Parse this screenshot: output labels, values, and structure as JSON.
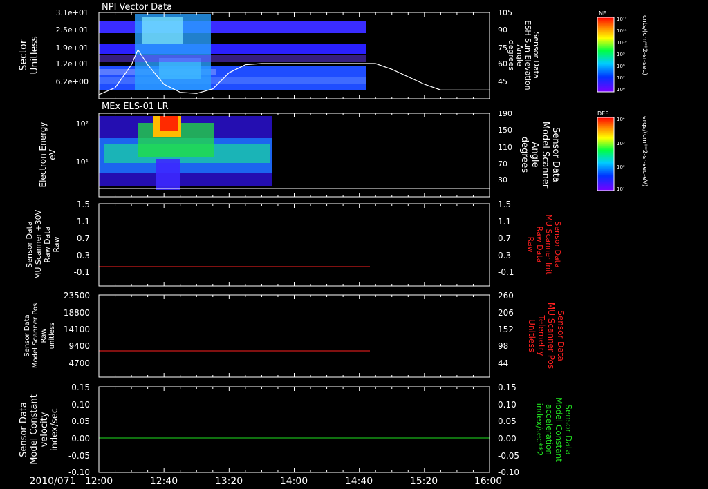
{
  "footer": {
    "date_label": "2010/071"
  },
  "x_ticks": [
    "12:00",
    "12:40",
    "13:20",
    "14:00",
    "14:40",
    "15:20",
    "16:00"
  ],
  "colors": {
    "frame": "#ffffff",
    "red": "#ff2020",
    "green": "#20e020",
    "bg": "#000000"
  },
  "chart_data": [
    {
      "type": "heatmap",
      "title": "NPI Vector Data",
      "ylabel_lines": [
        "Sector",
        "Unitless"
      ],
      "y_ticks": [
        "3.1e+01",
        "2.5e+01",
        "1.9e+01",
        "1.2e+01",
        "6.2e+00"
      ],
      "y_right_ticks": [
        "105",
        "90",
        "75",
        "60",
        "45"
      ],
      "right_label_lines": [
        "Sensor Data",
        "ESH Sun Elevation",
        "Angle",
        "degrees"
      ],
      "colorbar": {
        "label": "NF",
        "unit": "cnts/(cm**2-sr-sec)",
        "ticks": [
          "10¹²",
          "10¹¹",
          "10¹⁰",
          "10⁹",
          "10⁸",
          "10⁷",
          "10⁶"
        ]
      },
      "data_end_time": "14:44",
      "overlay_line": {
        "name": "ESH Sun Elevation Angle",
        "x": [
          "12:00",
          "12:10",
          "12:20",
          "12:24",
          "12:30",
          "12:40",
          "12:50",
          "13:00",
          "13:10",
          "13:20",
          "13:30",
          "13:40",
          "14:00",
          "14:20",
          "14:40",
          "14:50",
          "15:00",
          "15:20",
          "15:30",
          "15:40",
          "16:00"
        ],
        "y": [
          36,
          42,
          62,
          75,
          62,
          45,
          38,
          37,
          41,
          55,
          62,
          63,
          63,
          63,
          63,
          63,
          58,
          45,
          40,
          40,
          40
        ]
      }
    },
    {
      "type": "heatmap",
      "title": "MEx ELS-01 LR",
      "ylabel_lines": [
        "Electron Energy",
        "eV"
      ],
      "y_ticks": [
        "10²",
        "10¹"
      ],
      "y_right_ticks": [
        "190",
        "150",
        "110",
        "70",
        "30"
      ],
      "right_label_lines": [
        "Sensor Data",
        "Model Scanner",
        "Angle",
        "degrees"
      ],
      "colorbar": {
        "label": "DEF",
        "unit": "ergs/(cm**2-sr-sec-eV)",
        "ticks": [
          "10⁴",
          "10³",
          "10²",
          "10¹"
        ]
      },
      "data_end_time": "13:45",
      "overlay_line": {
        "name": "Model Scanner Angle",
        "x": [
          "12:00",
          "16:00"
        ],
        "y": [
          15,
          15
        ]
      }
    },
    {
      "type": "line",
      "ylabel_lines": [
        "Sensor Data",
        "MU Scanner +30V",
        "Raw Data",
        "Raw"
      ],
      "y_ticks": [
        "1.5",
        "1.1",
        "0.7",
        "0.3",
        "-0.1"
      ],
      "y_right_ticks": [
        "1.5",
        "1.1",
        "0.7",
        "0.3",
        "-0.1"
      ],
      "right_label_lines": [
        "Sensor Data",
        "MU Scanner Init",
        "Raw Data",
        "Raw"
      ],
      "ylim": [
        -0.4,
        1.5
      ],
      "series": [
        {
          "color": "#ff2020",
          "x": [
            "12:00",
            "14:44"
          ],
          "y": [
            0.0,
            0.0
          ]
        }
      ]
    },
    {
      "type": "line",
      "ylabel_lines": [
        "Sensor Data",
        "Model Scanner Pos",
        "Raw",
        "unitless"
      ],
      "y_ticks": [
        "23500",
        "18800",
        "14100",
        "9400",
        "4700"
      ],
      "y_right_ticks": [
        "260",
        "206",
        "152",
        "98",
        "44"
      ],
      "right_label_lines": [
        "Sensor Data",
        "MU Scanner Pos",
        "Telemetry",
        "Unitless"
      ],
      "ylim": [
        0,
        23500
      ],
      "series": [
        {
          "color": "#ff2020",
          "x": [
            "12:00",
            "14:44"
          ],
          "y": [
            7800,
            7800
          ]
        }
      ]
    },
    {
      "type": "line",
      "ylabel_lines": [
        "Sensor Data",
        "Model Constant",
        "velocity",
        "index/sec"
      ],
      "y_ticks": [
        "0.15",
        "0.10",
        "0.05",
        "0.00",
        "-0.05",
        "-0.10"
      ],
      "y_right_ticks": [
        "0.15",
        "0.10",
        "0.05",
        "0.00",
        "-0.05",
        "-0.10"
      ],
      "right_label_lines": [
        "Sensor Data",
        "Model Constant",
        "acceleration",
        "index/sec**2"
      ],
      "ylim": [
        -0.1,
        0.15
      ],
      "series": [
        {
          "color": "#20e020",
          "x": [
            "12:00",
            "16:00"
          ],
          "y": [
            0.0,
            0.0
          ]
        }
      ]
    }
  ]
}
